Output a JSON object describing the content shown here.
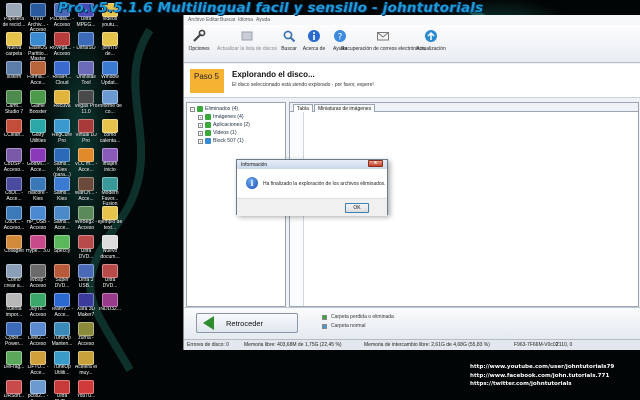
{
  "overlay_title": "Pro.v5.5.1.6 Multilingual facil y sensillo - johntutorials",
  "desktop": {
    "icons": [
      {
        "label": "Papelera de recicl...",
        "color": "#9aa8b8",
        "col": 0,
        "row": 0
      },
      {
        "label": "Nueva carpeta",
        "color": "#e6c34a",
        "col": 0,
        "row": 1
      },
      {
        "label": "sistem",
        "color": "#5c7da8",
        "col": 0,
        "row": 2
      },
      {
        "label": "Camt... Studio 7",
        "color": "#4d8a4d",
        "col": 0,
        "row": 3
      },
      {
        "label": "CClean...",
        "color": "#c44d3a",
        "col": 0,
        "row": 4
      },
      {
        "label": "CoDSP - Acceso...",
        "color": "#7a5aa8",
        "col": 0,
        "row": 5
      },
      {
        "label": "CoDi... - Acce...",
        "color": "#4a4a9e",
        "col": 0,
        "row": 6
      },
      {
        "label": "CoDr... - Acceso...",
        "color": "#3a7ab8",
        "col": 0,
        "row": 7
      },
      {
        "label": "Collagelt",
        "color": "#d08a3a",
        "col": 0,
        "row": 8
      },
      {
        "label": "Cómo crear a...",
        "color": "#8aa0b8",
        "col": 0,
        "row": 9
      },
      {
        "label": "cuenta impor...",
        "color": "#b8b8b8",
        "col": 0,
        "row": 10
      },
      {
        "label": "Cyber... Power...",
        "color": "#3a6ab8",
        "col": 0,
        "row": 11
      },
      {
        "label": "DeFrag...",
        "color": "#5aa85a",
        "col": 0,
        "row": 12
      },
      {
        "label": "DRSoft...",
        "color": "#c84a4a",
        "col": 0,
        "row": 13
      },
      {
        "label": "DVD Archiv... - Acceso",
        "color": "#2a5a9e",
        "col": 1,
        "row": 0
      },
      {
        "label": "EaseUS Partitio... Master",
        "color": "#3a8ad0",
        "col": 1,
        "row": 1
      },
      {
        "label": "Forma... - Acce...",
        "color": "#b8643a",
        "col": 1,
        "row": 2
      },
      {
        "label": "Game Booster",
        "color": "#4a9a4a",
        "col": 1,
        "row": 3
      },
      {
        "label": "Glary Utilities",
        "color": "#2aa8a8",
        "col": 1,
        "row": 4
      },
      {
        "label": "GodMi... - Acce...",
        "color": "#8a3ab8",
        "col": 1,
        "row": 5
      },
      {
        "label": "halcore - Kies",
        "color": "#3a78b8",
        "col": 1,
        "row": 6
      },
      {
        "label": "HP_USB - Acceso",
        "color": "#4a8ad0",
        "col": 1,
        "row": 7
      },
      {
        "label": "Hype... 3.0",
        "color": "#c84a8a",
        "col": 1,
        "row": 8
      },
      {
        "label": "IwBsp - Acceso",
        "color": "#6a6a6a",
        "col": 1,
        "row": 9
      },
      {
        "label": "JoyTo... Acceso",
        "color": "#3aa86a",
        "col": 1,
        "row": 10
      },
      {
        "label": "LiveU... - Acceso",
        "color": "#5a8ad0",
        "col": 1,
        "row": 11
      },
      {
        "label": "LiFTO... - Acce...",
        "color": "#d0a03a",
        "col": 1,
        "row": 12
      },
      {
        "label": "pcos2... - Acce...",
        "color": "#6a9ad0",
        "col": 1,
        "row": 13
      },
      {
        "label": "PLData... - Acceso",
        "color": "#4a6ab8",
        "col": 2,
        "row": 0
      },
      {
        "label": "R6Vega... - Acceso",
        "color": "#b83a3a",
        "col": 2,
        "row": 1
      },
      {
        "label": "RealPl... Cloud",
        "color": "#3a6ad0",
        "col": 2,
        "row": 2
      },
      {
        "label": "Recuva",
        "color": "#e0b43a",
        "col": 2,
        "row": 3
      },
      {
        "label": "RegCure Pro",
        "color": "#3a9ad0",
        "col": 2,
        "row": 4
      },
      {
        "label": "Sams... Kies (para...)",
        "color": "#2a6ab8",
        "col": 2,
        "row": 5
      },
      {
        "label": "Sams... Kies",
        "color": "#3a7ad0",
        "col": 2,
        "row": 6
      },
      {
        "label": "Sams... Acce...",
        "color": "#4a8ac8",
        "col": 2,
        "row": 7
      },
      {
        "label": "Speccy",
        "color": "#5ab85a",
        "col": 2,
        "row": 8
      },
      {
        "label": "Super DVD...",
        "color": "#b85a3a",
        "col": 2,
        "row": 9
      },
      {
        "label": "TeamV... - Acce...",
        "color": "#2a6ad0",
        "col": 2,
        "row": 10
      },
      {
        "label": "TuneUp Manten...",
        "color": "#3a8ab8",
        "col": 2,
        "row": 11
      },
      {
        "label": "TuneUp Utiliti...",
        "color": "#3a9ac8",
        "col": 2,
        "row": 12
      },
      {
        "label": "Ultra DVD...",
        "color": "#c83a3a",
        "col": 2,
        "row": 13
      },
      {
        "label": "Ultra MPEG...",
        "color": "#4a4ab8",
        "col": 3,
        "row": 0
      },
      {
        "label": "UltraISO",
        "color": "#3a6ab8",
        "col": 3,
        "row": 1
      },
      {
        "label": "Uninstall Tool",
        "color": "#6a6ab8",
        "col": 3,
        "row": 2
      },
      {
        "label": "Vegas Pro 11.0",
        "color": "#4a4a4a",
        "col": 3,
        "row": 3
      },
      {
        "label": "Virtual DJ Pro",
        "color": "#a83a3a",
        "col": 3,
        "row": 4
      },
      {
        "label": "VLC m... - Acce...",
        "color": "#e08a2a",
        "col": 3,
        "row": 5
      },
      {
        "label": "WarCh... - Acce...",
        "color": "#6a4a3a",
        "col": 3,
        "row": 6
      },
      {
        "label": "WeBeg2 - Acceso",
        "color": "#5a8a5a",
        "col": 3,
        "row": 7
      },
      {
        "label": "Ultra DVD...",
        "color": "#b84a4a",
        "col": 3,
        "row": 8
      },
      {
        "label": "Ultra 3 USB...",
        "color": "#4a6ab8",
        "col": 3,
        "row": 9
      },
      {
        "label": "Xara 3D Maker7",
        "color": "#3a3a9a",
        "col": 3,
        "row": 10
      },
      {
        "label": "zurna - Acceso",
        "color": "#8a8a3a",
        "col": 3,
        "row": 11
      },
      {
        "label": "Acelera el muy...",
        "color": "#c8a03a",
        "col": 3,
        "row": 12
      },
      {
        "label": "YouTu...",
        "color": "#d03a3a",
        "col": 3,
        "row": 13
      },
      {
        "label": "videos youtu...",
        "color": "#e6c34a",
        "col": 4,
        "row": 0
      },
      {
        "label": "john79 de...",
        "color": "#e6c34a",
        "col": 4,
        "row": 1
      },
      {
        "label": "Window Updat...",
        "color": "#3a7ad0",
        "col": 4,
        "row": 2
      },
      {
        "label": "Informe de co...",
        "color": "#6a9ad0",
        "col": 4,
        "row": 3
      },
      {
        "label": "como calenta...",
        "color": "#e6c34a",
        "col": 4,
        "row": 4
      },
      {
        "label": "imajen inicio",
        "color": "#8a5ab8",
        "col": 4,
        "row": 5
      },
      {
        "label": "Modern Favor... Fusion",
        "color": "#3a9a9a",
        "col": 4,
        "row": 6
      },
      {
        "label": "ejemplo de text...",
        "color": "#e6c34a",
        "col": 4,
        "row": 7
      },
      {
        "label": "Nuevo docum...",
        "color": "#dcdcdc",
        "col": 4,
        "row": 8
      },
      {
        "label": "Ultra DVD...",
        "color": "#b84a4a",
        "col": 4,
        "row": 9
      },
      {
        "label": "INDD32...",
        "color": "#9a3a8a",
        "col": 4,
        "row": 10
      }
    ]
  },
  "app": {
    "menu": [
      "Archivo",
      "Editar",
      "Buscar",
      "Idioma",
      "Ayuda"
    ],
    "toolbar": [
      {
        "label": "Opciones",
        "icon": "wrench-icon",
        "dim": false
      },
      {
        "label": "Actualizar la lista de discos",
        "icon": "refresh-icon",
        "dim": true
      },
      {
        "label": "Buscar",
        "icon": "search-icon",
        "dim": false
      },
      {
        "label": "Acerca de",
        "icon": "info-icon",
        "dim": false
      },
      {
        "label": "Ayuda",
        "icon": "help-icon",
        "dim": false
      },
      {
        "label": "Recuperación de correos electrónicos",
        "icon": "mail-icon",
        "dim": false
      },
      {
        "label": "Actualización",
        "icon": "update-icon",
        "dim": false
      }
    ],
    "step": {
      "badge": "Paso 5",
      "title": "Explorando el disco...",
      "subtitle": "El disco seleccionado está siendo explorado - por favor, espere!"
    },
    "tree": [
      {
        "label": "Eliminados (4)",
        "level": 0,
        "color": "#3aa83a"
      },
      {
        "label": "Imágenes (4)",
        "level": 1,
        "color": "#3aa83a"
      },
      {
        "label": "Aplicaciones (2)",
        "level": 1,
        "color": "#3aa83a"
      },
      {
        "label": "Videos (1)",
        "level": 1,
        "color": "#3aa83a"
      },
      {
        "label": "Block 507 (1)",
        "level": 1,
        "color": "#3a8ad0"
      }
    ],
    "tabs": [
      "Tabla",
      "Miniaturas de imágenes"
    ],
    "back_button": "Retroceder",
    "legend": [
      {
        "label": "Carpeta perdida o eliminada",
        "color": "#3aa83a"
      },
      {
        "label": "Carpeta normal",
        "color": "#4a9ad0"
      }
    ],
    "status": [
      "Errores de disco: 0",
      "Memoria libre: 403,68M de 1,75G (22,45 %)",
      "Memoria de intercambio libre: 2,61G de 4,68G (55,83 %)",
      "F963-7F66M-V0c02",
      "2110, 0"
    ]
  },
  "dialog": {
    "title": "Información",
    "close": "x",
    "message": "Ha finalizado la exploración de los archivos eliminados.",
    "ok": "OK",
    "icon": "info-icon"
  },
  "social_links": [
    "http://www.youtube.com/user/johntutorials79",
    "http://www.facebook.com/john.tutorials.771",
    "https://twitter.com/johntutorials"
  ]
}
